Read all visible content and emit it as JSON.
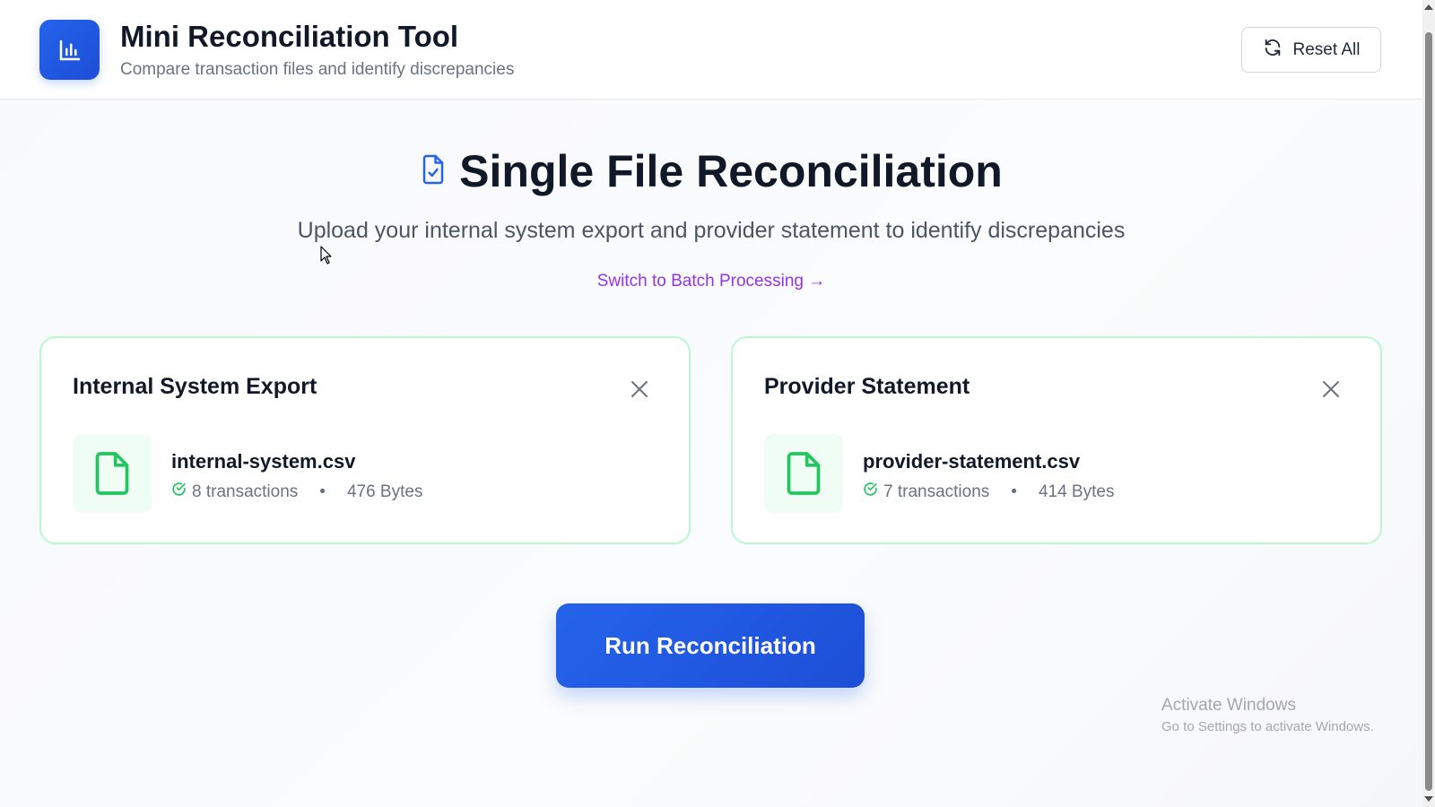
{
  "header": {
    "app_title": "Mini Reconciliation Tool",
    "app_subtitle": "Compare transaction files and identify discrepancies",
    "reset_label": "Reset All"
  },
  "hero": {
    "title": "Single File Reconciliation",
    "subtitle": "Upload your internal system export and provider statement to identify discrepancies",
    "switch_link": "Switch to Batch Processing →"
  },
  "cards": [
    {
      "title": "Internal System Export",
      "file_name": "internal-system.csv",
      "transactions": "8 transactions",
      "size": "476 Bytes"
    },
    {
      "title": "Provider Statement",
      "file_name": "provider-statement.csv",
      "transactions": "7 transactions",
      "size": "414 Bytes"
    }
  ],
  "actions": {
    "run_label": "Run Reconciliation"
  },
  "watermark": {
    "title": "Activate Windows",
    "subtitle": "Go to Settings to activate Windows."
  },
  "colors": {
    "accent": "#2563eb",
    "success": "#22c55e",
    "link": "#9333ea"
  },
  "icons": {
    "logo": "bar-chart-icon",
    "reset": "refresh-icon",
    "hero": "file-check-icon",
    "close": "close-icon",
    "file": "file-icon",
    "check": "check-circle-icon"
  }
}
